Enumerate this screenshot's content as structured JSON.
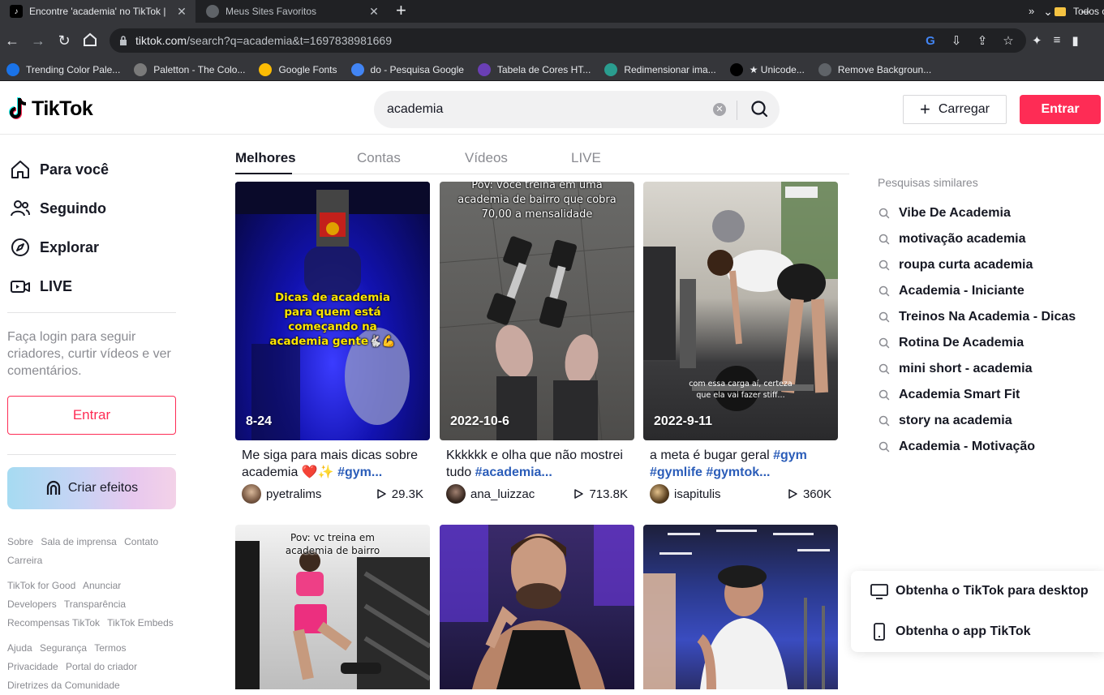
{
  "browser": {
    "tabs": [
      {
        "title": "Encontre 'academia' no TikTok |",
        "active": true
      },
      {
        "title": "Meus Sites Favoritos",
        "active": false
      }
    ],
    "url_host": "tiktok.com",
    "url_path": "/search?q=academia&t=1697838981669",
    "bookmarks": [
      {
        "label": "Trending Color Pale...",
        "color": "#1a73e8"
      },
      {
        "label": "Paletton - The Colo...",
        "color": "#7a7a7a"
      },
      {
        "label": "Google Fonts",
        "color": "#fbbc04"
      },
      {
        "label": "do - Pesquisa Google",
        "color": "#4285f4"
      },
      {
        "label": "Tabela de Cores HT...",
        "color": "#6a3fb5"
      },
      {
        "label": "Redimensionar ima...",
        "color": "#2a9d8f"
      },
      {
        "label": "★ Unicode...",
        "color": "#000000"
      },
      {
        "label": "Remove Backgroun...",
        "color": "#5f6368"
      }
    ],
    "bookmarks_folder": "Todos o"
  },
  "header": {
    "logo": "TikTok",
    "search_value": "academia",
    "upload_label": "Carregar",
    "login_label": "Entrar"
  },
  "sidebar": {
    "nav": [
      {
        "label": "Para você",
        "icon": "home-icon"
      },
      {
        "label": "Seguindo",
        "icon": "users-icon"
      },
      {
        "label": "Explorar",
        "icon": "compass-icon"
      },
      {
        "label": "LIVE",
        "icon": "live-icon"
      }
    ],
    "login_hint": "Faça login para seguir criadores, curtir vídeos e ver comentários.",
    "login_label": "Entrar",
    "effects_label": "Criar efeitos",
    "footer_group1": [
      "Sobre",
      "Sala de imprensa",
      "Contato",
      "Carreira"
    ],
    "footer_group2": [
      "TikTok for Good",
      "Anunciar",
      "Developers",
      "Transparência",
      "Recompensas TikTok",
      "TikTok Embeds"
    ],
    "footer_group3": [
      "Ajuda",
      "Segurança",
      "Termos",
      "Privacidade",
      "Portal do criador",
      "Diretrizes da Comunidade"
    ]
  },
  "main": {
    "tabs": [
      "Melhores",
      "Contas",
      "Vídeos",
      "LIVE"
    ],
    "videos": [
      {
        "date": "8-24",
        "caption": "Me siga para mais dicas sobre academia ❤️✨ ",
        "tag": "#gym...",
        "user": "pyetralims",
        "views": "29.3K",
        "overlay": "Dicas de academia para quem está começando na academia gente🐇💪"
      },
      {
        "date": "2022-10-6",
        "caption": "Kkkkkk e olha que não mostrei tudo ",
        "tag": "#academia...",
        "user": "ana_luizzac",
        "views": "713.8K",
        "overlay": "Pov: você treina em uma academia de bairro que cobra 70,00 a mensalidade"
      },
      {
        "date": "2022-9-11",
        "caption": "a meta é bugar geral ",
        "tag": "#gym #gymlife #gymtok...",
        "user": "isapitulis",
        "views": "360K",
        "overlay": "com essa carga aí, certeza que ela vai fazer stiff..."
      },
      {
        "date": "",
        "caption": "",
        "tag": "",
        "user": "",
        "views": "",
        "overlay": "Pov: vc treina em academia de bairro"
      },
      {
        "date": "",
        "caption": "",
        "tag": "",
        "user": "",
        "views": "",
        "overlay": ""
      },
      {
        "date": "",
        "caption": "",
        "tag": "",
        "user": "",
        "views": "",
        "overlay": ""
      }
    ]
  },
  "related": {
    "title": "Pesquisas similares",
    "items": [
      "Vibe De Academia",
      "motivação academia",
      "roupa curta academia",
      "Academia - Iniciante",
      "Treinos Na Academia - Dicas",
      "Rotina De Academia",
      "mini short - academia",
      "Academia Smart Fit",
      "story na academia",
      "Academia - Motivação"
    ]
  },
  "get_app": {
    "desktop": "Obtenha o TikTok para desktop",
    "mobile": "Obtenha o app TikTok"
  },
  "colors": {
    "brand": "#fe2c55",
    "hashtag": "#2b5db9"
  }
}
